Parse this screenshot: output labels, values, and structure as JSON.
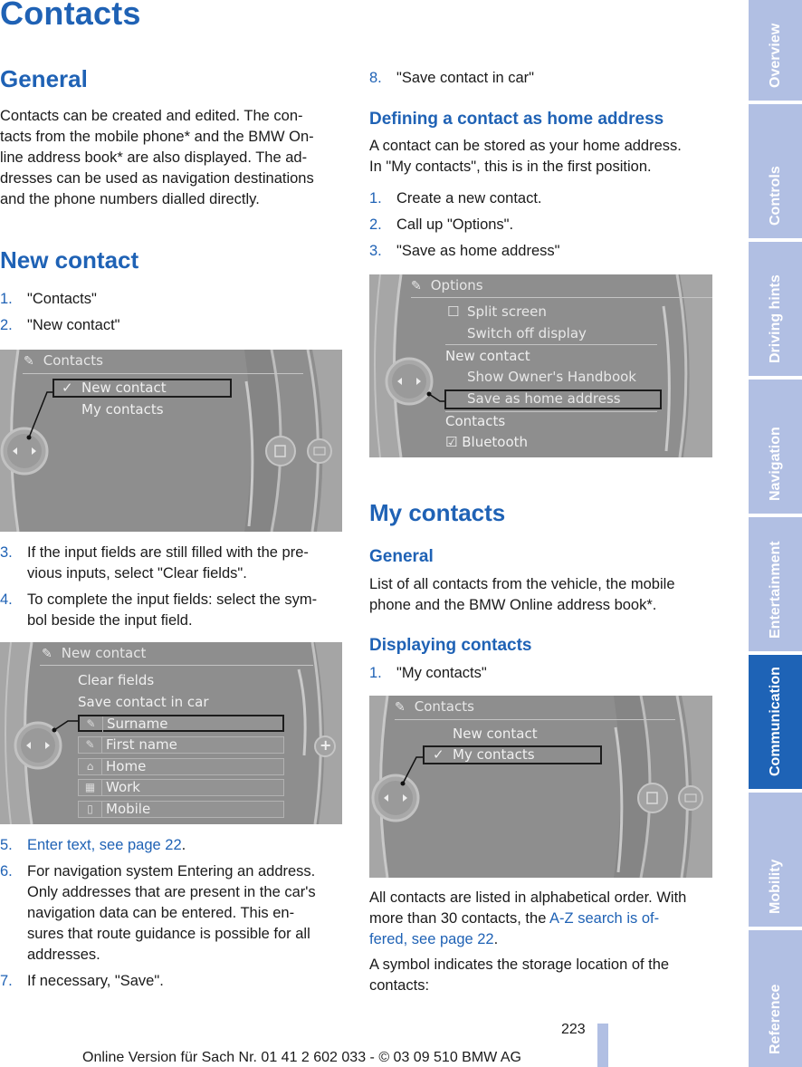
{
  "page_title": "Contacts",
  "left": {
    "general_heading": "General",
    "general_text": "Contacts can be created and edited. The contacts from the mobile phone* and the BMW Online address book* are also displayed. The addresses can be used as navigation destinations and the phone numbers dialled directly.",
    "general_lines": [
      "Contacts can be created and edited. The con-",
      "tacts from the mobile phone* and the BMW On-",
      "line address book* are also displayed. The ad-",
      "dresses can be used as navigation destinations",
      "and the phone numbers dialled directly."
    ],
    "new_contact_heading": "New contact",
    "steps_a": [
      {
        "num": "1.",
        "text": "\"Contacts\""
      },
      {
        "num": "2.",
        "text": "\"New contact\""
      }
    ],
    "screen1": {
      "title": "Contacts",
      "title_icon": "contacts-book-icon",
      "items": [
        {
          "label": "New contact",
          "checked": true,
          "selected": true
        },
        {
          "label": "My contacts",
          "checked": false,
          "selected": false
        }
      ]
    },
    "steps_b": [
      {
        "num": "3.",
        "lines": [
          "If the input fields are still filled with the pre-",
          "vious inputs, select \"Clear fields\"."
        ]
      },
      {
        "num": "4.",
        "lines": [
          "To complete the input fields: select the sym-",
          "bol beside the input field."
        ]
      }
    ],
    "screen2": {
      "title": "New contact",
      "title_icon": "new-contact-icon",
      "actions": [
        "Clear fields",
        "Save contact in car"
      ],
      "fields": [
        {
          "icon": "person-edit-icon",
          "glyph": "✎",
          "label": "Surname",
          "selected": true
        },
        {
          "icon": "person-edit-icon",
          "glyph": "✎",
          "label": "First name",
          "selected": false
        },
        {
          "icon": "home-edit-icon",
          "glyph": "⌂",
          "label": "Home",
          "selected": false
        },
        {
          "icon": "work-edit-icon",
          "glyph": "▦",
          "label": "Work",
          "selected": false
        },
        {
          "icon": "mobile-edit-icon",
          "glyph": "▯",
          "label": "Mobile",
          "selected": false
        }
      ],
      "plus_label": "+"
    },
    "steps_c": [
      {
        "num": "5.",
        "link": "Enter text, see page 22",
        "after": "."
      },
      {
        "num": "6.",
        "lines": [
          "For navigation system Entering an address.",
          "Only addresses that are present in the car's",
          "navigation data can be entered. This en-",
          "sures that route guidance is possible for all",
          "addresses."
        ]
      },
      {
        "num": "7.",
        "lines": [
          "If necessary, \"Save\"."
        ]
      }
    ]
  },
  "right": {
    "step_8": {
      "num": "8.",
      "text": "\"Save contact in car\""
    },
    "home_heading": "Defining a contact as home address",
    "home_lines": [
      "A contact can be stored as your home address.",
      "In \"My contacts\", this is in the first position."
    ],
    "home_steps": [
      {
        "num": "1.",
        "text": "Create a new contact."
      },
      {
        "num": "2.",
        "text": "Call up \"Options\"."
      },
      {
        "num": "3.",
        "text": "\"Save as home address\""
      }
    ],
    "screen3": {
      "title": "Options",
      "title_icon": "options-icon",
      "items": [
        {
          "label": "Split screen",
          "prefix": "☐",
          "level": "sub"
        },
        {
          "label": "Switch off display",
          "prefix": "",
          "level": "sub"
        },
        {
          "label": "New contact",
          "prefix": "",
          "level": "group"
        },
        {
          "label": "Show Owner's Handbook",
          "prefix": "",
          "level": "sub"
        },
        {
          "label": "Save as home address",
          "prefix": "",
          "level": "sub",
          "selected": true
        },
        {
          "label": "Contacts",
          "prefix": "",
          "level": "group"
        },
        {
          "label": "Bluetooth",
          "prefix": "☑",
          "level": "group"
        }
      ]
    },
    "my_contacts_heading": "My contacts",
    "general_heading": "General",
    "general_lines": [
      "List of all contacts from the vehicle, the mobile",
      "phone and the BMW Online address book*."
    ],
    "displaying_heading": "Displaying contacts",
    "displaying_steps": [
      {
        "num": "1.",
        "text": "\"My contacts\""
      }
    ],
    "screen4": {
      "title": "Contacts",
      "title_icon": "contacts-book-icon",
      "items": [
        {
          "label": "New contact",
          "checked": false,
          "selected": false
        },
        {
          "label": "My contacts",
          "checked": true,
          "selected": true
        }
      ]
    },
    "alpha_lines_1": "All contacts are listed in alphabetical order. With",
    "alpha_line_2_pre": "more than 30 contacts, the ",
    "alpha_link_1": "A-Z search is of-",
    "alpha_link_2": "fered, see page 22",
    "alpha_after": ".",
    "symbol_lines": [
      "A symbol indicates the storage location of the",
      "contacts:"
    ]
  },
  "side_tabs": [
    {
      "label": "Overview",
      "active": false
    },
    {
      "label": "Controls",
      "active": false
    },
    {
      "label": "Driving hints",
      "active": false
    },
    {
      "label": "Navigation",
      "active": false
    },
    {
      "label": "Entertainment",
      "active": false
    },
    {
      "label": "Communication",
      "active": true
    },
    {
      "label": "Mobility",
      "active": false
    },
    {
      "label": "Reference",
      "active": false
    }
  ],
  "footer": {
    "page_number": "223",
    "text": "Online Version für Sach Nr. 01 41 2 602 033 - © 03 09 510 BMW AG"
  },
  "colors": {
    "accent_blue": "#1f62b5",
    "tab_inactive": "#b1bfe3",
    "tab_active": "#1e63b6",
    "screen_gray": "#8d8d8d"
  }
}
